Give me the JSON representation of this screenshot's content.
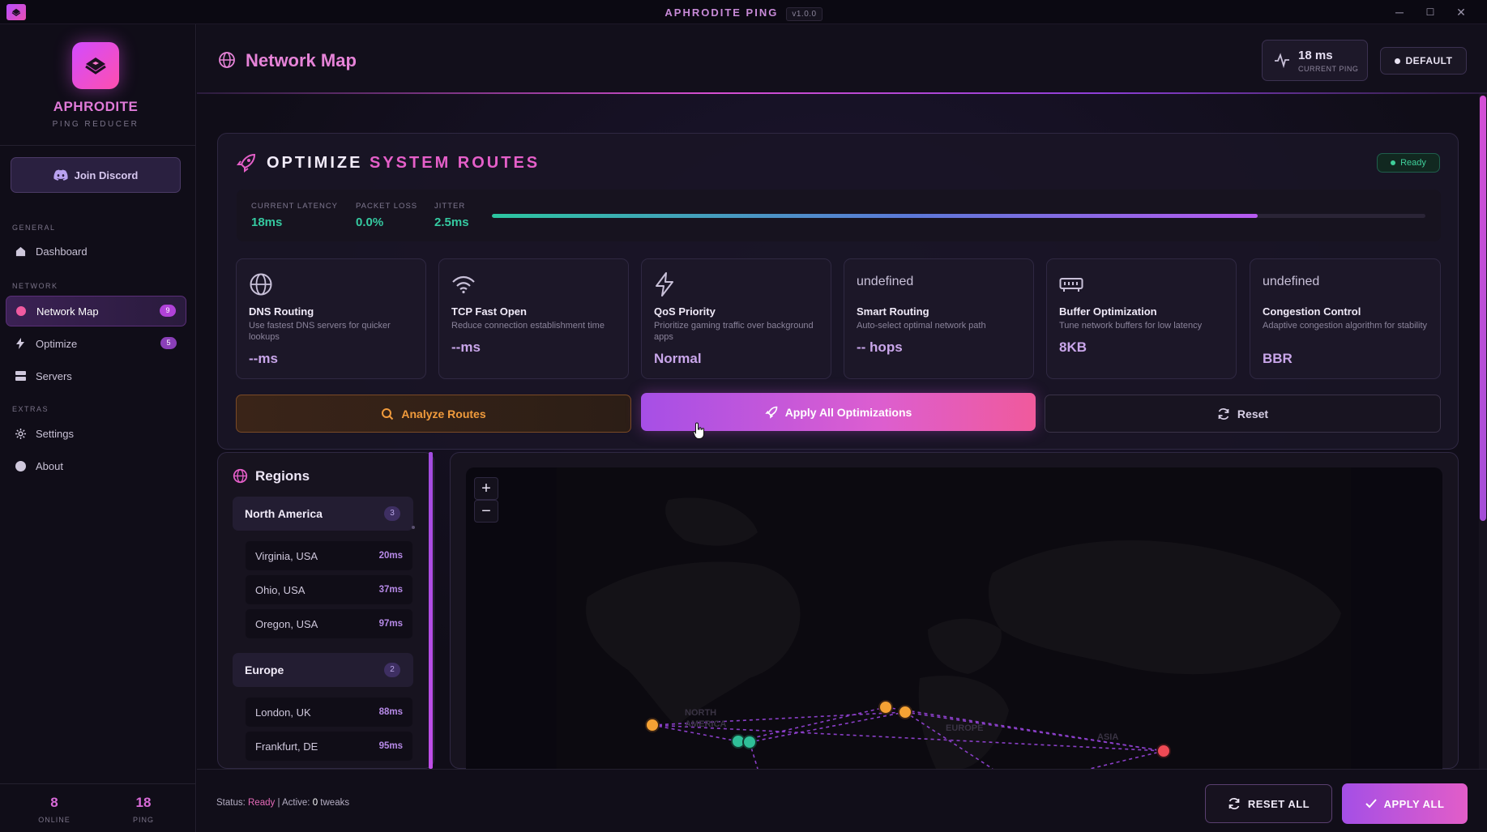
{
  "app": {
    "title": "APHRODITE PING",
    "version": "v1.0.0"
  },
  "window_controls": {
    "minimize": "─",
    "maximize": "☐",
    "close": "✕"
  },
  "brand": {
    "name": "APHRODITE",
    "subtitle": "PING REDUCER"
  },
  "sidebar": {
    "discord_label": "Join Discord",
    "sections": {
      "general": "GENERAL",
      "network": "NETWORK",
      "extras": "EXTRAS"
    },
    "items": [
      {
        "label": "Dashboard",
        "icon": "home-icon"
      },
      {
        "label": "Network Map",
        "icon": "dot-icon",
        "badge": "9",
        "active": true
      },
      {
        "label": "Optimize",
        "icon": "bolt-icon",
        "badge": "5"
      },
      {
        "label": "Servers",
        "icon": "server-icon"
      },
      {
        "label": "Settings",
        "icon": "gear-icon"
      },
      {
        "label": "About",
        "icon": "info-icon"
      }
    ],
    "stats": [
      {
        "value": "8",
        "label": "ONLINE"
      },
      {
        "value": "18",
        "label": "PING"
      }
    ]
  },
  "header": {
    "title": "Network Map",
    "ping_value": "18 ms",
    "ping_label": "CURRENT PING",
    "profile": "DEFAULT"
  },
  "optimize": {
    "title_a": "OPTIMIZE ",
    "title_b": "SYSTEM ROUTES",
    "status": "Ready",
    "metrics": [
      {
        "label": "CURRENT LATENCY",
        "value": "18ms"
      },
      {
        "label": "PACKET LOSS",
        "value": "0.0%"
      },
      {
        "label": "JITTER",
        "value": "2.5ms"
      }
    ],
    "progress": 0.82,
    "tweaks": [
      {
        "icon": "globe-icon",
        "name": "DNS Routing",
        "desc": "Use fastest DNS servers for quicker lookups",
        "value": "--ms"
      },
      {
        "icon": "wifi-icon",
        "name": "TCP Fast Open",
        "desc": "Reduce connection establishment time",
        "value": "--ms"
      },
      {
        "icon": "bolt-icon",
        "name": "QoS Priority",
        "desc": "Prioritize gaming traffic over background apps",
        "value": "Normal"
      },
      {
        "icon_text": "undefined",
        "name": "Smart Routing",
        "desc": "Auto-select optimal network path",
        "value": "-- hops"
      },
      {
        "icon": "memory-icon",
        "name": "Buffer Optimization",
        "desc": "Tune network buffers for low latency",
        "value": "8KB"
      },
      {
        "icon_text": "undefined",
        "name": "Congestion Control",
        "desc": "Adaptive congestion algorithm for stability",
        "value": "BBR"
      }
    ],
    "buttons": {
      "analyze": "Analyze Routes",
      "apply": "Apply All Optimizations",
      "reset": "Reset"
    }
  },
  "regions": {
    "title": "Regions",
    "groups": [
      {
        "name": "North America",
        "count": "3",
        "servers": [
          {
            "name": "Virginia, USA",
            "ping": "20ms"
          },
          {
            "name": "Ohio, USA",
            "ping": "37ms"
          },
          {
            "name": "Oregon, USA",
            "ping": "97ms"
          }
        ]
      },
      {
        "name": "Europe",
        "count": "2",
        "servers": [
          {
            "name": "London, UK",
            "ping": "88ms"
          },
          {
            "name": "Frankfurt, DE",
            "ping": "95ms"
          }
        ]
      }
    ]
  },
  "map": {
    "zoom_in": "+",
    "zoom_out": "−",
    "labels": [
      "NORTH",
      "AMERICA",
      "EUROPE",
      "ASIA"
    ],
    "colors": {
      "good": "#2fbf98",
      "mid": "#f5a234",
      "bad": "#ef4a55",
      "route": "#8a3fc8"
    }
  },
  "footer": {
    "status_prefix": "Status: ",
    "status_value": "Ready",
    "active_prefix": " | Active: ",
    "active_count": "0",
    "active_suffix": " tweaks",
    "reset_all": "RESET ALL",
    "apply_all": "APPLY ALL"
  },
  "colors": {
    "accent": "#e55fc9",
    "purple": "#a64fe6",
    "green": "#35c9a0",
    "orange": "#f19b3c"
  }
}
